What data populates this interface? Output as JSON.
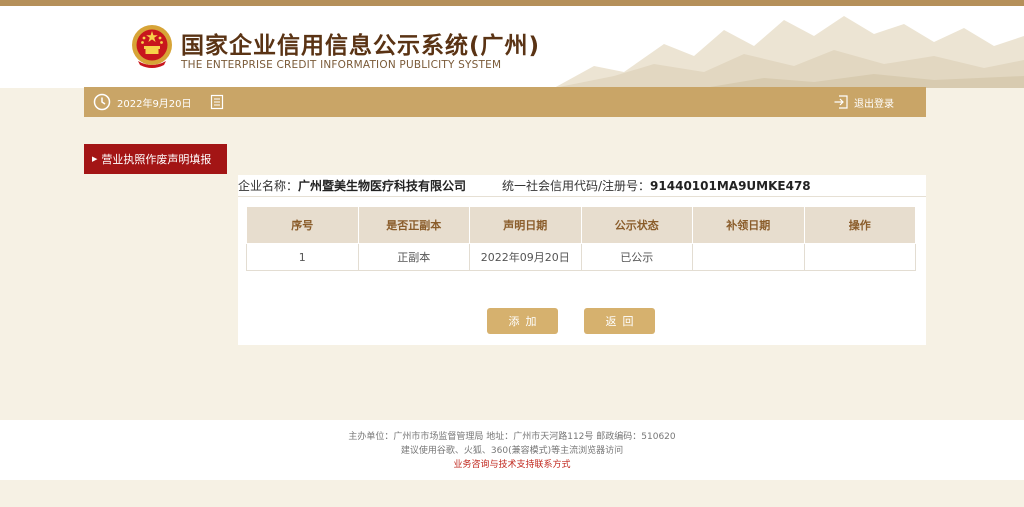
{
  "header": {
    "title": "国家企业信用信息公示系统(广州)",
    "subtitle": "THE ENTERPRISE CREDIT INFORMATION PUBLICITY SYSTEM",
    "emblem_icon": "national-emblem-icon"
  },
  "toolbar": {
    "date": "2022年9月20日",
    "logout_label": "退出登录"
  },
  "sidebar": {
    "items": [
      {
        "label": "营业执照作废声明填报",
        "active": true
      }
    ]
  },
  "company": {
    "name_label": "企业名称：",
    "name": "广州暨美生物医疗科技有限公司",
    "code_label": "统一社会信用代码/注册号：",
    "code": "91440101MA9UMKE478"
  },
  "table": {
    "headers": [
      "序号",
      "是否正副本",
      "声明日期",
      "公示状态",
      "补领日期",
      "操作"
    ],
    "rows": [
      [
        "1",
        "正副本",
        "2022年09月20日",
        "已公示",
        "",
        ""
      ]
    ]
  },
  "actions": {
    "add_label": "添加",
    "back_label": "返回"
  },
  "footer": {
    "line1": "主办单位：广州市市场监督管理局    地址：广州市天河路112号    邮政编码：510620",
    "line2": "建议使用谷歌、火狐、360(兼容模式)等主流浏览器访问",
    "contact_link": "业务咨询与技术支持联系方式"
  },
  "colors": {
    "accent_gold": "#c9a567",
    "active_red": "#a31515",
    "title_brown": "#5a3314"
  }
}
